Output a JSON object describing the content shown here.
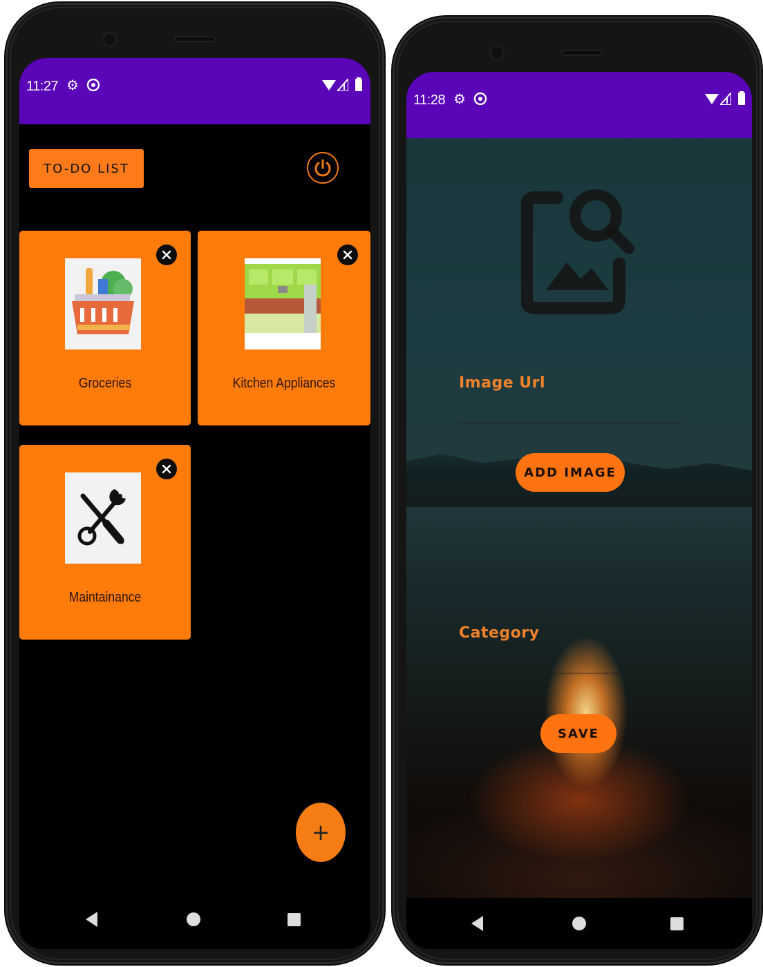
{
  "phone_left": {
    "status": {
      "time": "11:27"
    },
    "header": {
      "title_button": "TO-DO LIST"
    },
    "cards": [
      {
        "label": "Groceries",
        "image": "grocery-basket-image"
      },
      {
        "label": "Kitchen Appliances",
        "image": "kitchen-image"
      },
      {
        "label": "Maintainance",
        "image": "tools-image"
      }
    ],
    "fab": {
      "label": "+"
    }
  },
  "phone_right": {
    "status": {
      "time": "11:28"
    },
    "form": {
      "image_url_label": "Image Url",
      "add_image_button": "ADD IMAGE",
      "category_label": "Category",
      "save_button": "SAVE"
    }
  },
  "colors": {
    "accent": "#ff7b0a",
    "status_bar": "#5a06b8",
    "background": "#000000"
  },
  "icons": [
    "settings-icon",
    "data-saver-icon",
    "wifi-icon",
    "signal-icon",
    "battery-icon",
    "power-icon",
    "close-icon",
    "image-search-icon",
    "back-icon",
    "home-icon",
    "recents-icon"
  ]
}
